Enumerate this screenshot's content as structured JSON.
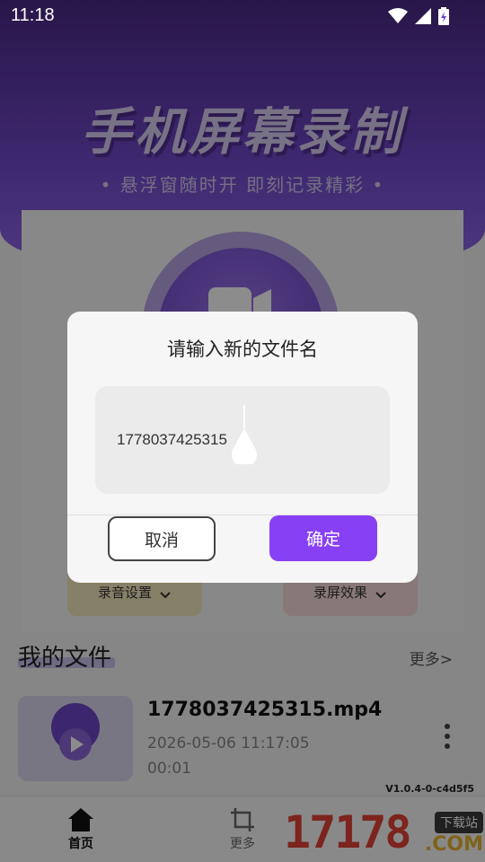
{
  "status_bar": {
    "time": "11:18",
    "icons": [
      "wifi-icon",
      "signal-icon",
      "battery-charging-icon"
    ]
  },
  "hero": {
    "title": "手机屏幕录制",
    "subtitle": "• 悬浮窗随时开  即刻记录精彩 •"
  },
  "settings": {
    "audio_label": "录音设置",
    "screen_label": "录屏效果"
  },
  "files": {
    "title": "我的文件",
    "more_label": "更多>",
    "items": [
      {
        "name": "1778037425315.mp4",
        "date": "2026-05-06 11:17:05",
        "duration": "00:01"
      }
    ]
  },
  "version": "V1.0.4-0-c4d5f5",
  "bottom_nav": {
    "home_label": "首页",
    "more_label": "更多"
  },
  "watermark": {
    "number": "17178",
    "tag": "下载站",
    "com": ".COM"
  },
  "dialog": {
    "title": "请输入新的文件名",
    "input_value": "1778037425315",
    "cancel_label": "取消",
    "confirm_label": "确定"
  },
  "colors": {
    "accent": "#8840f5",
    "hero_top": "#4b2a86",
    "hero_bottom": "#8b63e6"
  }
}
